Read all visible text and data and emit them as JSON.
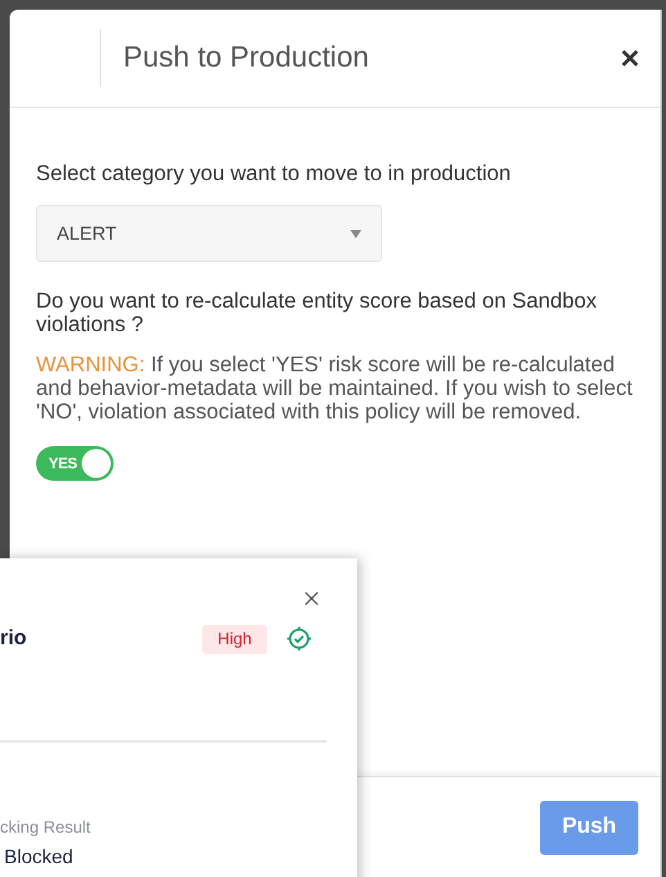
{
  "dialog": {
    "title": "Push to Production",
    "category_label": "Select category you want to move to in production",
    "category_select": {
      "value": "ALERT"
    },
    "question": "Do you want to re-calculate entity score based on Sandbox violations ?",
    "warning": {
      "label": "WARNING:",
      "text": "If you select 'YES' risk score will be re-calculated and behavior-metadata will be maintained. If you wish to select 'NO', violation associated with this policy will be removed."
    },
    "toggle": {
      "label": "YES",
      "on": true
    },
    "push_button": "Push"
  },
  "overlay_card": {
    "title": "rio",
    "severity": "High",
    "field_label": "cking Result",
    "field_value": "Blocked"
  }
}
